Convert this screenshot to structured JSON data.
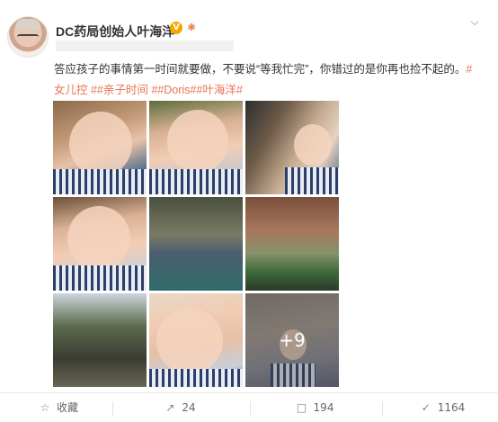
{
  "post": {
    "author": "DC药局创始人叶海洋",
    "verified_badge": "V",
    "fan_badge": "❃",
    "text": "答应孩子的事情第一时间就要做，不要说“等我忙完”，你错过的是你再也捡不起的。",
    "tags": "#女儿控 ##亲子时间 ##Doris##叶海洋#",
    "more_photos": "+9",
    "menu_icon": "chevron-down-icon"
  },
  "actions": {
    "favorite": {
      "icon": "star-icon",
      "label": "收藏"
    },
    "repost": {
      "icon": "share-icon",
      "label": "24"
    },
    "comment": {
      "icon": "comment-icon",
      "label": "194"
    },
    "like": {
      "icon": "thumbs-up-icon",
      "label": "1164"
    }
  },
  "colors": {
    "tag": "#eb7350",
    "verified": "#f7a600"
  }
}
